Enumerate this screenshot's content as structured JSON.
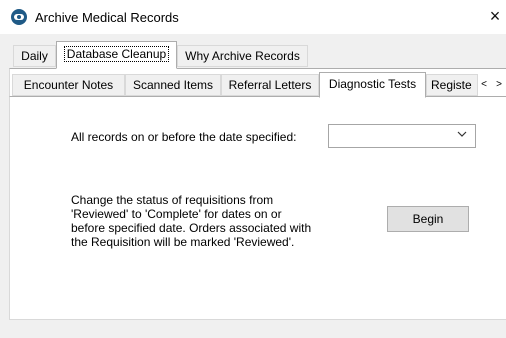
{
  "window": {
    "title": "Archive Medical Records",
    "close_glyph": "×",
    "icon": "app-logo-icon"
  },
  "main_tabs": [
    {
      "label": "Daily",
      "active": false
    },
    {
      "label": "Database Cleanup",
      "active": true
    },
    {
      "label": "Why Archive Records",
      "active": false
    }
  ],
  "sub_tabs": [
    {
      "label": "Encounter Notes",
      "active": false
    },
    {
      "label": "Scanned Items",
      "active": false
    },
    {
      "label": "Referral Letters",
      "active": false
    },
    {
      "label": "Diagnostic Tests",
      "active": true
    },
    {
      "label": "Registe",
      "active": false
    }
  ],
  "tab_scroll": {
    "left": "<",
    "right": ">"
  },
  "date_section": {
    "label": "All records on or before the date specified:",
    "selected_value": "",
    "dropdown_icon": "chevron-down-icon"
  },
  "description": "Change the status of requisitions from\n'Reviewed' to 'Complete' for dates on or\nbefore specified date. Orders associated with\nthe Requisition will be marked 'Reviewed'.",
  "actions": {
    "begin_label": "Begin"
  }
}
